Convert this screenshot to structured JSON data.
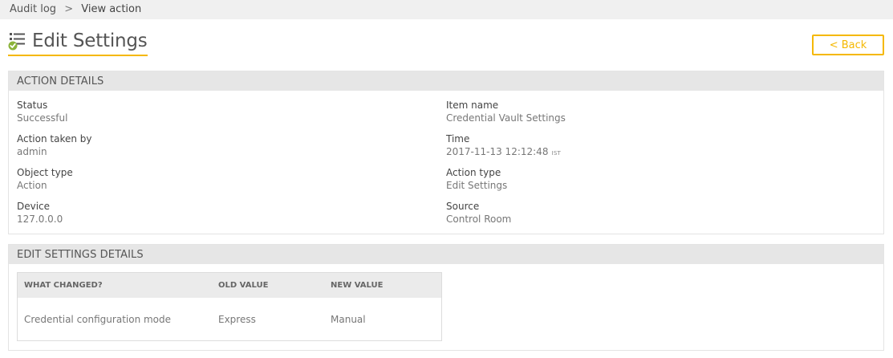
{
  "breadcrumb": {
    "parent": "Audit log",
    "separator": ">",
    "current": "View action"
  },
  "header": {
    "title": "Edit Settings",
    "icon": "checklist-icon",
    "back_label": "< Back",
    "accent_color": "#f5b800"
  },
  "action_details": {
    "heading": "ACTION DETAILS",
    "status_label": "Status",
    "status_value": "Successful",
    "taken_by_label": "Action taken by",
    "taken_by_value": "admin",
    "object_type_label": "Object type",
    "object_type_value": "Action",
    "device_label": "Device",
    "device_value": "127.0.0.0",
    "item_name_label": "Item name",
    "item_name_value": "Credential Vault Settings",
    "time_label": "Time",
    "time_value": "2017-11-13 12:12:48",
    "time_zone": "IST",
    "action_type_label": "Action type",
    "action_type_value": "Edit Settings",
    "source_label": "Source",
    "source_value": "Control Room"
  },
  "edit_details": {
    "heading": "EDIT SETTINGS DETAILS",
    "columns": {
      "what": "WHAT CHANGED?",
      "old": "OLD VALUE",
      "new": "NEW VALUE"
    },
    "rows": [
      {
        "what": "Credential configuration mode",
        "old": "Express",
        "new": "Manual"
      }
    ]
  }
}
